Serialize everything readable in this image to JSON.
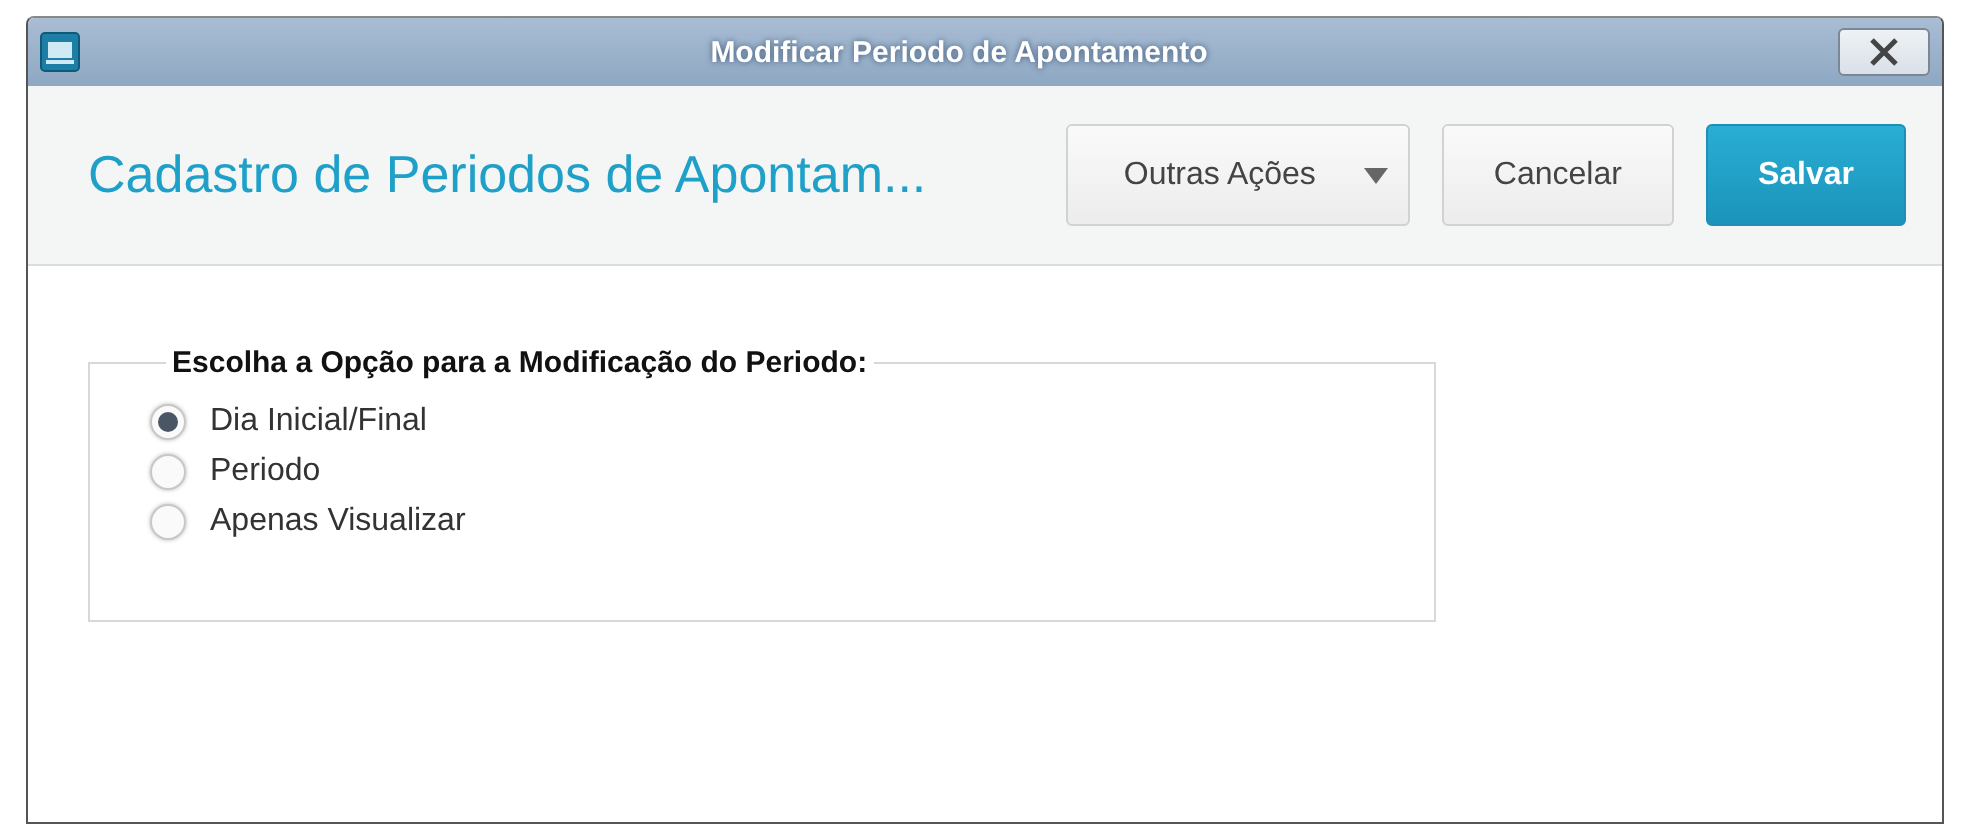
{
  "window": {
    "title": "Modificar Periodo de Apontamento"
  },
  "header": {
    "title": "Cadastro de Periodos de Apontam...",
    "buttons": [
      {
        "label": "Outras Ações",
        "kind": "dropdown"
      },
      {
        "label": "Cancelar",
        "kind": "secondary"
      },
      {
        "label": "Salvar",
        "kind": "primary"
      }
    ]
  },
  "group": {
    "legend": "Escolha a Opção para a Modificação do Periodo:",
    "options": [
      {
        "label": "Dia Inicial/Final",
        "selected": true
      },
      {
        "label": "Periodo",
        "selected": false
      },
      {
        "label": "Apenas Visualizar",
        "selected": false
      }
    ]
  }
}
